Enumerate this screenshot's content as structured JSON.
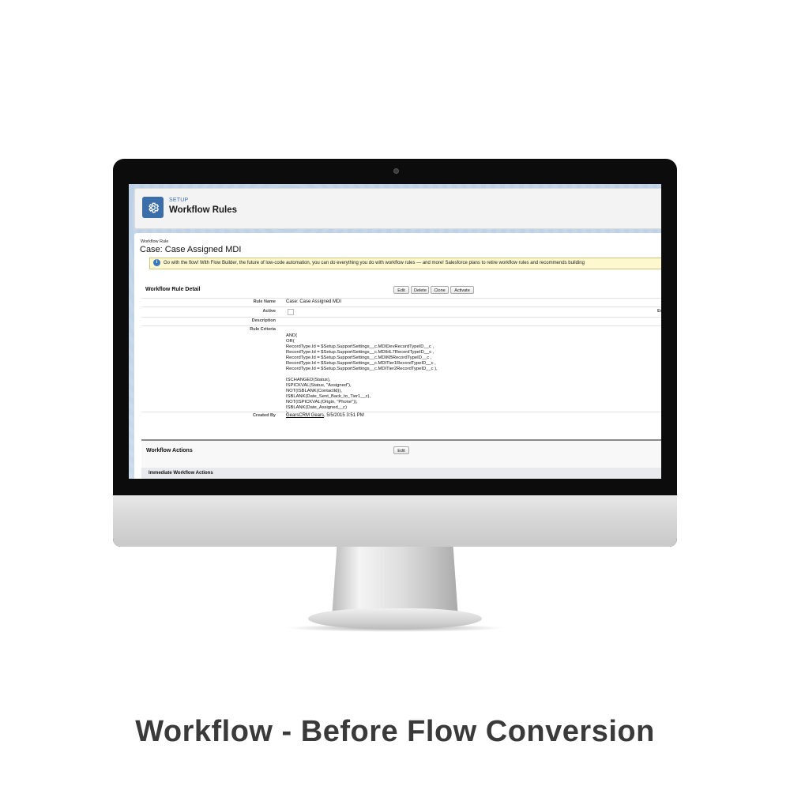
{
  "header": {
    "setup_label": "SETUP",
    "title": "Workflow Rules"
  },
  "rule": {
    "small_label": "Workflow Rule",
    "title": "Case: Case Assigned MDI"
  },
  "banner": {
    "text": "Go with the flow! With Flow Builder, the future of low-code automation, you can do everything you do with workflow rules — and more! Salesforce plans to retire workflow rules and recommends building"
  },
  "detail": {
    "section_title": "Workflow Rule Detail",
    "buttons": [
      "Edit",
      "Delete",
      "Clone",
      "Activate"
    ],
    "rule_name_label": "Rule Name",
    "rule_name_value": "Case: Case Assigned MDI",
    "active_label": "Active",
    "active_checked": false,
    "ev_label": "Ev",
    "description_label": "Description",
    "description_value": "",
    "criteria_label": "Rule Criteria",
    "criteria_lines": [
      "AND(",
      "OR(",
      "RecordType.Id = $Setup.SupportSettings__c.MDIDevRecordTypeID__c ,",
      "RecordType.Id = $Setup.SupportSettings__c.MDIHL7RecordTypeID__c ,",
      "RecordType.Id = $Setup.SupportSettings__c.MDIKBRecordTypeID__c ,",
      "RecordType.Id = $Setup.SupportSettings__c.MDITier1RecordTypeID__c ,",
      "RecordType.Id = $Setup.SupportSettings__c.MDITier2RecordTypeID__c ),",
      "",
      "ISCHANGED(Status),",
      "ISPICKVAL(Status, \"Assigned\"),",
      "NOT(ISBLANK(ContactId)),",
      "ISBLANK(Date_Sent_Back_to_Tier1__c),",
      "NOT(ISPICKVAL(Origin, \"Phone\")),",
      "ISBLANK(Date_Assigned__c)",
      ")"
    ],
    "created_by_label": "Created By",
    "created_by_user": "GearsCRM Gears",
    "created_by_date": ", 5/5/2015 3:51 PM"
  },
  "actions": {
    "section_title": "Workflow Actions",
    "edit_label": "Edit",
    "immediate_title": "Immediate Workflow Actions"
  },
  "caption": "Workflow - Before Flow Conversion",
  "colors": {
    "accent": "#3b6da8",
    "banner_bg": "#fdf8cf",
    "caption": "#3a3a3a"
  }
}
